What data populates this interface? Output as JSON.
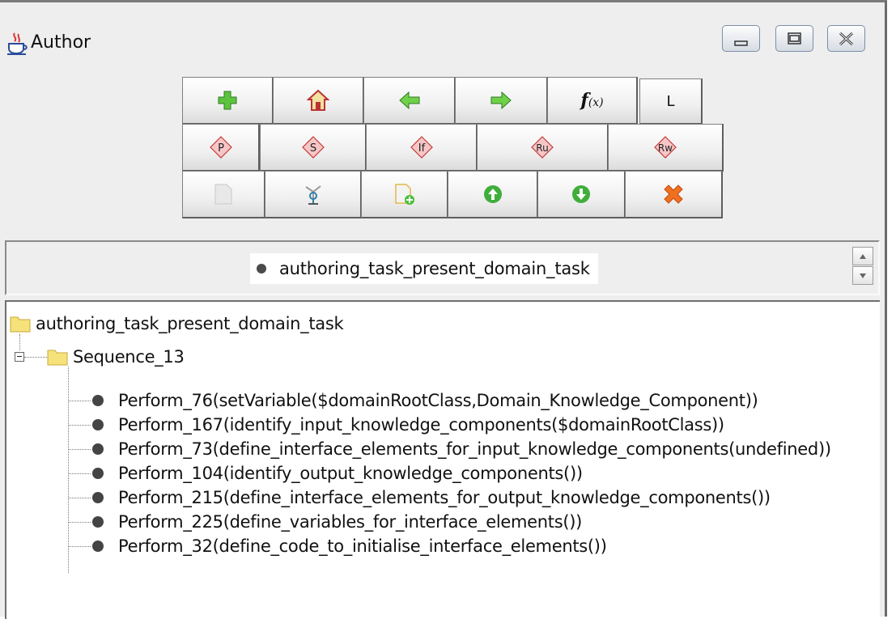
{
  "window": {
    "title": "Author",
    "app_icon": "java-cup-icon",
    "controls": [
      "minimize-icon",
      "restore-icon",
      "close-icon"
    ]
  },
  "toolbar": {
    "row1": [
      {
        "name": "add",
        "icon": "green-plus-icon"
      },
      {
        "name": "home",
        "icon": "home-icon"
      },
      {
        "name": "back",
        "icon": "green-left-arrow-icon"
      },
      {
        "name": "forward",
        "icon": "green-right-arrow-icon"
      },
      {
        "name": "function",
        "icon": "function-icon",
        "label": "f(x)"
      },
      {
        "name": "L",
        "label": "L"
      }
    ],
    "row2": [
      {
        "name": "P",
        "label": "P"
      },
      {
        "name": "S",
        "label": "S"
      },
      {
        "name": "If",
        "label": "If"
      },
      {
        "name": "Ru",
        "label": "Ru"
      },
      {
        "name": "Rw",
        "label": "Rw"
      }
    ],
    "row3": [
      {
        "name": "document",
        "icon": "blank-document-icon"
      },
      {
        "name": "network",
        "icon": "network-icon"
      },
      {
        "name": "new-document",
        "icon": "document-add-icon"
      },
      {
        "name": "move-up",
        "icon": "green-up-circle-icon"
      },
      {
        "name": "move-down",
        "icon": "green-down-circle-icon"
      },
      {
        "name": "delete",
        "icon": "red-x-icon"
      }
    ]
  },
  "current_node": {
    "label": "authoring_task_present_domain_task"
  },
  "tree": {
    "root": "authoring_task_present_domain_task",
    "sequence": "Sequence_13",
    "items": [
      "Perform_76(setVariable($domainRootClass,Domain_Knowledge_Component))",
      "Perform_167(identify_input_knowledge_components($domainRootClass))",
      "Perform_73(define_interface_elements_for_input_knowledge_components(undefined))",
      "Perform_104(identify_output_knowledge_components())",
      "Perform_215(define_interface_elements_for_output_knowledge_components())",
      "Perform_225(define_variables_for_interface_elements())",
      "Perform_32(define_code_to_initialise_interface_elements())"
    ]
  },
  "colors": {
    "diamond_fill": "#f6c6c6",
    "diamond_stroke": "#c43a3a",
    "folder": "#f5e27a",
    "green_icon": "#4bbf3a",
    "delete_icon": "#f07020"
  }
}
